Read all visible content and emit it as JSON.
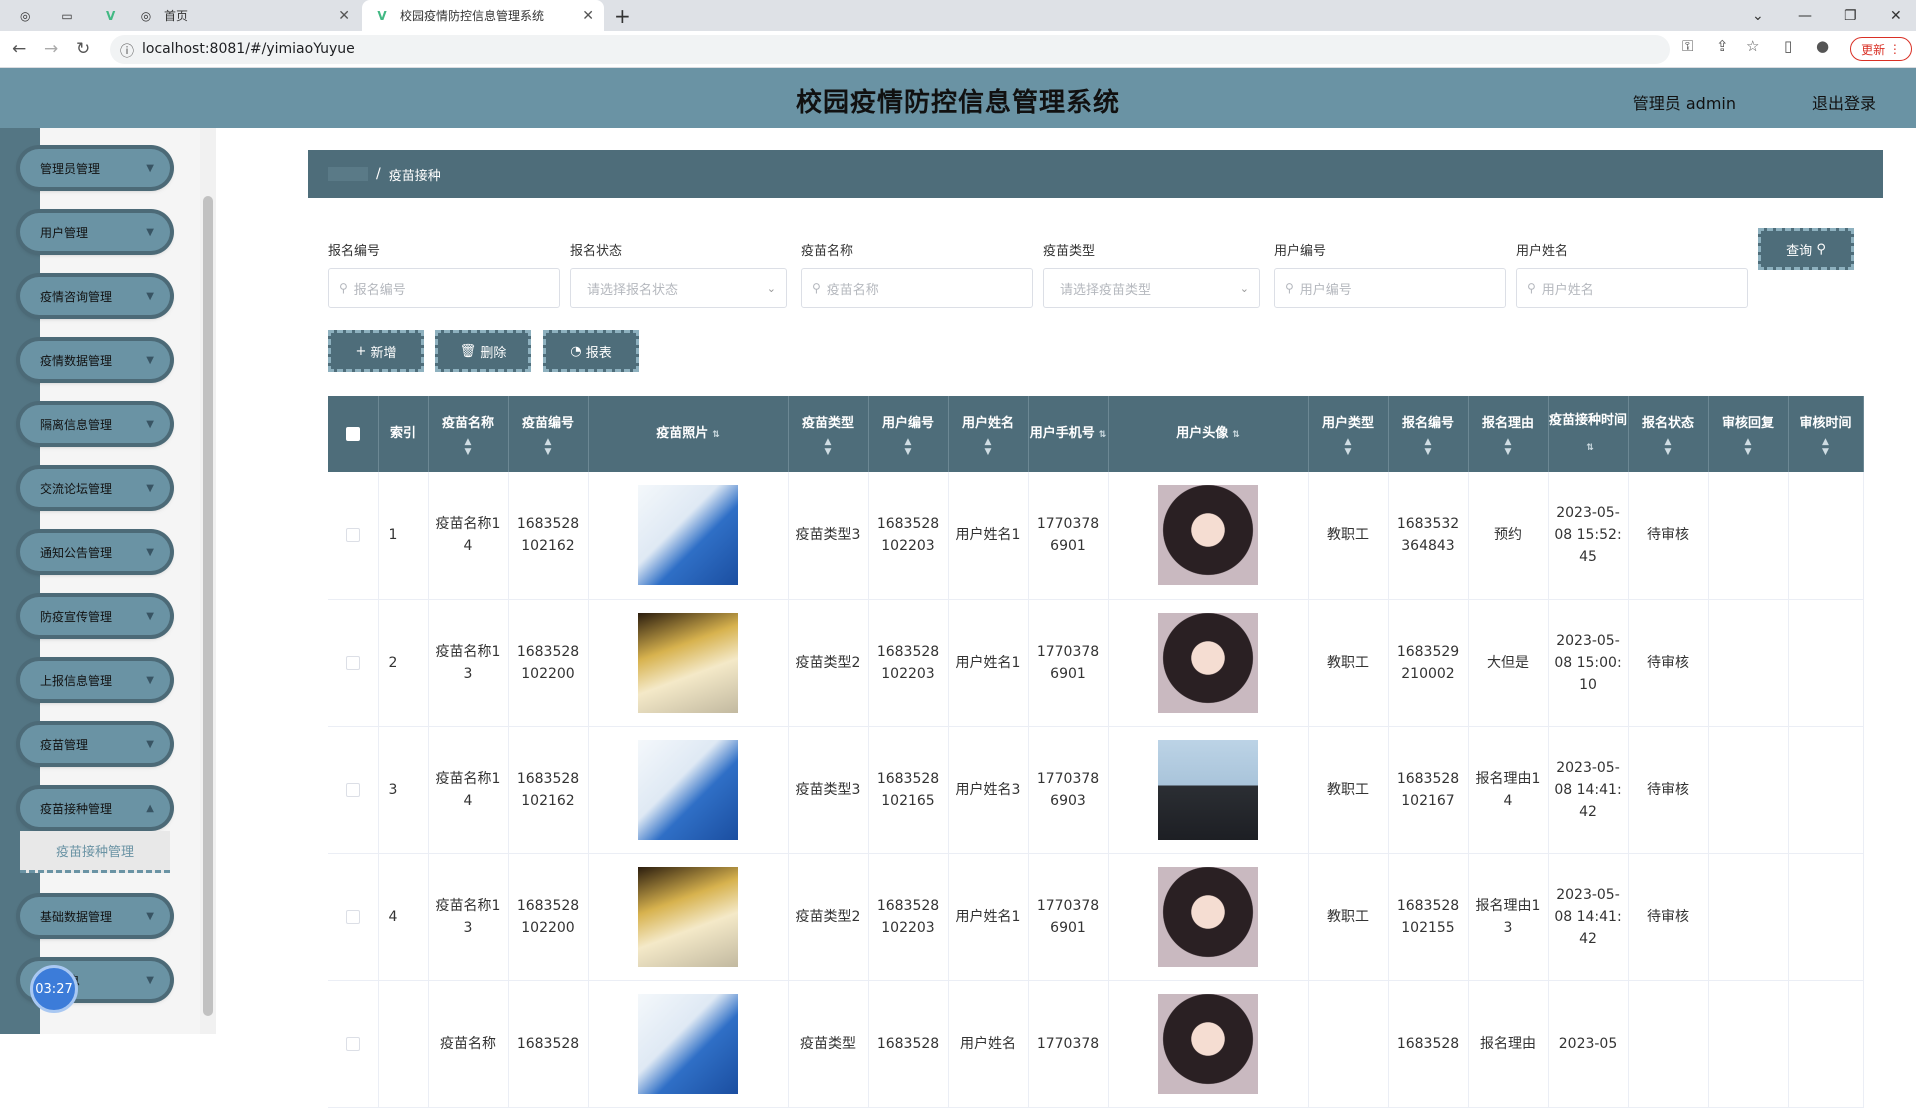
{
  "browser": {
    "tabs": [
      {
        "title": ""
      },
      {
        "title": ""
      },
      {
        "title": ""
      },
      {
        "title": "首页"
      },
      {
        "title": "校园疫情防控信息管理系统"
      }
    ],
    "url": "localhost:8081/#/yimiaoYuyue",
    "update_label": "更新"
  },
  "header": {
    "title": "校园疫情防控信息管理系统",
    "user": "管理员 admin",
    "logout": "退出登录"
  },
  "sidebar": {
    "items": [
      {
        "label": "管理员管理"
      },
      {
        "label": "用户管理"
      },
      {
        "label": "疫情咨询管理"
      },
      {
        "label": "疫情数据管理"
      },
      {
        "label": "隔离信息管理"
      },
      {
        "label": "交流论坛管理"
      },
      {
        "label": "通知公告管理"
      },
      {
        "label": "防疫宣传管理"
      },
      {
        "label": "上报信息管理"
      },
      {
        "label": "疫苗管理"
      },
      {
        "label": "疫苗接种管理"
      },
      {
        "label": "基础数据管理"
      },
      {
        "label": "息"
      }
    ],
    "sub_item": "疫苗接种管理",
    "timer": "03:27"
  },
  "breadcrumb": {
    "sep": "/",
    "current": "疫苗接种"
  },
  "filters": [
    {
      "label": "报名编号",
      "placeholder": "报名编号",
      "type": "input"
    },
    {
      "label": "报名状态",
      "placeholder": "请选择报名状态",
      "type": "select"
    },
    {
      "label": "疫苗名称",
      "placeholder": "疫苗名称",
      "type": "input"
    },
    {
      "label": "疫苗类型",
      "placeholder": "请选择疫苗类型",
      "type": "select"
    },
    {
      "label": "用户编号",
      "placeholder": "用户编号",
      "type": "input"
    },
    {
      "label": "用户姓名",
      "placeholder": "用户姓名",
      "type": "input"
    }
  ],
  "buttons": {
    "query": "查询",
    "add": "新增",
    "delete": "删除",
    "report": "报表"
  },
  "table": {
    "columns": [
      "索引",
      "疫苗名称",
      "疫苗编号",
      "疫苗照片",
      "疫苗类型",
      "用户编号",
      "用户姓名",
      "用户手机号",
      "用户头像",
      "用户类型",
      "报名编号",
      "报名理由",
      "疫苗接种时间",
      "报名状态",
      "审核回复",
      "审核时间"
    ],
    "rows": [
      {
        "index": "1",
        "vname": "疫苗名称14",
        "vno": "1683528102162",
        "photo": "vac1",
        "vtype": "疫苗类型3",
        "uno": "1683528102203",
        "uname": "用户姓名1",
        "phone": "17703786901",
        "avatar": "av1",
        "utype": "教职工",
        "bno": "1683532364843",
        "reason": "预约",
        "time": "2023-05-08 15:52:45",
        "status": "待审核",
        "reply": "",
        "rtime": ""
      },
      {
        "index": "2",
        "vname": "疫苗名称13",
        "vno": "1683528102200",
        "photo": "vac2",
        "vtype": "疫苗类型2",
        "uno": "1683528102203",
        "uname": "用户姓名1",
        "phone": "17703786901",
        "avatar": "av1",
        "utype": "教职工",
        "bno": "1683529210002",
        "reason": "大但是",
        "time": "2023-05-08 15:00:10",
        "status": "待审核",
        "reply": "",
        "rtime": ""
      },
      {
        "index": "3",
        "vname": "疫苗名称14",
        "vno": "1683528102162",
        "photo": "vac1",
        "vtype": "疫苗类型3",
        "uno": "1683528102165",
        "uname": "用户姓名3",
        "phone": "17703786903",
        "avatar": "av2",
        "utype": "教职工",
        "bno": "1683528102167",
        "reason": "报名理由14",
        "time": "2023-05-08 14:41:42",
        "status": "待审核",
        "reply": "",
        "rtime": ""
      },
      {
        "index": "4",
        "vname": "疫苗名称13",
        "vno": "1683528102200",
        "photo": "vac2",
        "vtype": "疫苗类型2",
        "uno": "1683528102203",
        "uname": "用户姓名1",
        "phone": "17703786901",
        "avatar": "av1",
        "utype": "教职工",
        "bno": "1683528102155",
        "reason": "报名理由13",
        "time": "2023-05-08 14:41:42",
        "status": "待审核",
        "reply": "",
        "rtime": ""
      },
      {
        "index": "",
        "vname": "疫苗名称",
        "vno": "1683528",
        "photo": "vac1",
        "vtype": "疫苗类型",
        "uno": "1683528",
        "uname": "用户姓名",
        "phone": "1770378",
        "avatar": "av1",
        "utype": "",
        "bno": "1683528",
        "reason": "报名理由",
        "time": "2023-05",
        "status": "",
        "reply": "",
        "rtime": ""
      }
    ]
  }
}
